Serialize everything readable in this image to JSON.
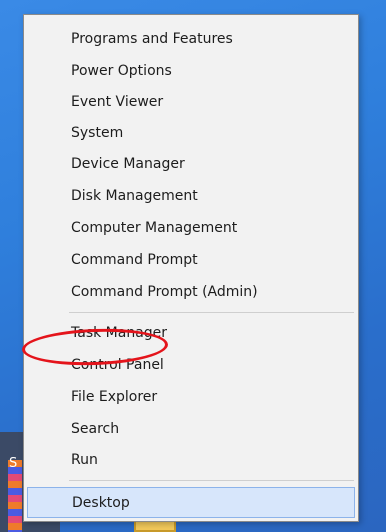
{
  "menu": {
    "items": [
      {
        "label": "Programs and Features"
      },
      {
        "label": "Power Options"
      },
      {
        "label": "Event Viewer"
      },
      {
        "label": "System"
      },
      {
        "label": "Device Manager"
      },
      {
        "label": "Disk Management"
      },
      {
        "label": "Computer Management"
      },
      {
        "label": "Command Prompt"
      },
      {
        "label": "Command Prompt (Admin)"
      },
      {
        "label": "Task Manager"
      },
      {
        "label": "Control Panel"
      },
      {
        "label": "File Explorer"
      },
      {
        "label": "Search"
      },
      {
        "label": "Run"
      },
      {
        "label": "Desktop"
      }
    ],
    "selected_item": "Desktop",
    "highlighted_item": "Control Panel"
  },
  "taskbar": {
    "start_letter": "S"
  },
  "colors": {
    "annotation": "#e4141b",
    "selection": "#d7e6fb",
    "desktop_background": "#2b78d6"
  }
}
